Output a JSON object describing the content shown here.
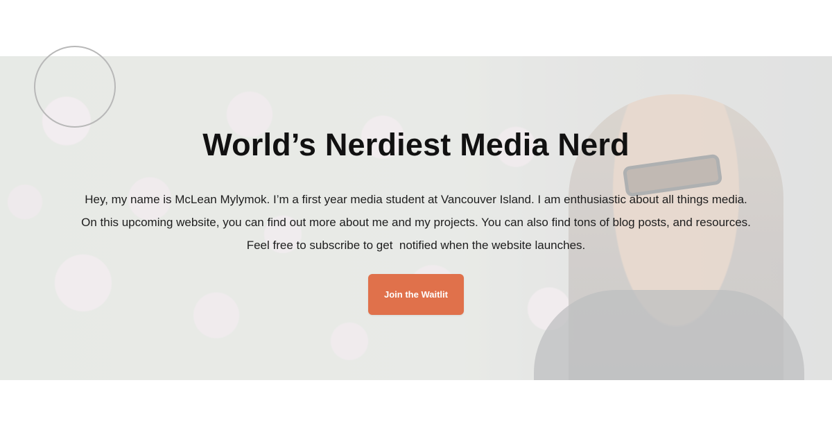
{
  "hero": {
    "title": "World’s Nerdiest Media Nerd",
    "intro": "Hey, my name is McLean Mylymok. I’m a first year media student at Vancouver Island. I am enthusiastic about all things media. On this upcoming website, you can find out more about me and my projects. You can also find tons of blog posts, and resources. Feel free to subscribe to get  notified when the website launches.",
    "cta_label": "Join the Waitlit"
  },
  "colors": {
    "accent": "#e0714b",
    "text": "#111111",
    "background": "#ffffff"
  }
}
